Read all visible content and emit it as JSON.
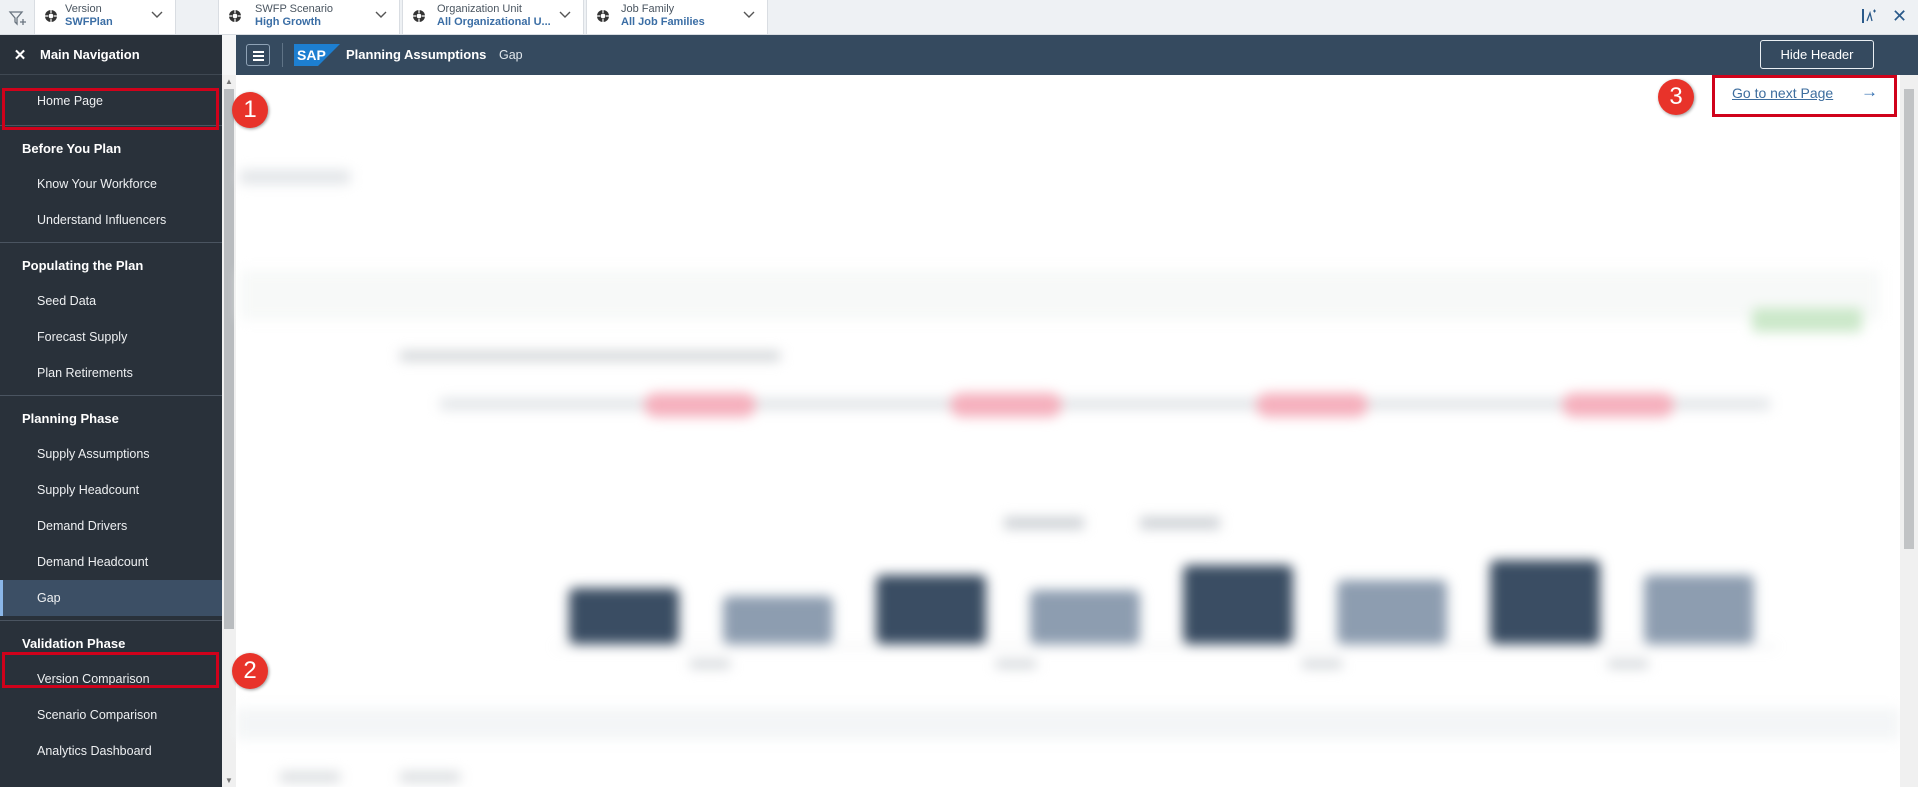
{
  "filters": [
    {
      "label": "Version",
      "value": "SWFPlan"
    },
    {
      "label": "SWFP Scenario",
      "value": "High Growth"
    },
    {
      "label": "Organization Unit",
      "value": "All Organizational U..."
    },
    {
      "label": "Job Family",
      "value": "All Job Families"
    }
  ],
  "toolbar": {
    "close_symbol": "✕"
  },
  "nav": {
    "title": "Main Navigation",
    "close_symbol": "✕",
    "home": "Home Page",
    "sections": [
      {
        "title": "Before You Plan",
        "items": [
          "Know Your Workforce",
          "Understand Influencers"
        ]
      },
      {
        "title": "Populating the Plan",
        "items": [
          "Seed Data",
          "Forecast Supply",
          "Plan Retirements"
        ]
      },
      {
        "title": "Planning Phase",
        "items": [
          "Supply Assumptions",
          "Supply Headcount",
          "Demand Drivers",
          "Demand Headcount",
          "Gap"
        ]
      },
      {
        "title": "Validation Phase",
        "items": [
          "Version Comparison",
          "Scenario Comparison",
          "Analytics Dashboard"
        ]
      }
    ],
    "active_item": "Gap"
  },
  "shell": {
    "logo": "SAP",
    "title": "Planning Assumptions",
    "subtitle": "Gap",
    "hide_header": "Hide Header"
  },
  "content": {
    "next_page": "Go to next Page",
    "next_arrow": "→"
  },
  "callouts": [
    "1",
    "2",
    "3"
  ],
  "colors": {
    "shell": "#354a5f",
    "nav": "#29313a",
    "highlight": "#d0021b",
    "badge": "#e8332a",
    "link": "#3d6d9e"
  }
}
